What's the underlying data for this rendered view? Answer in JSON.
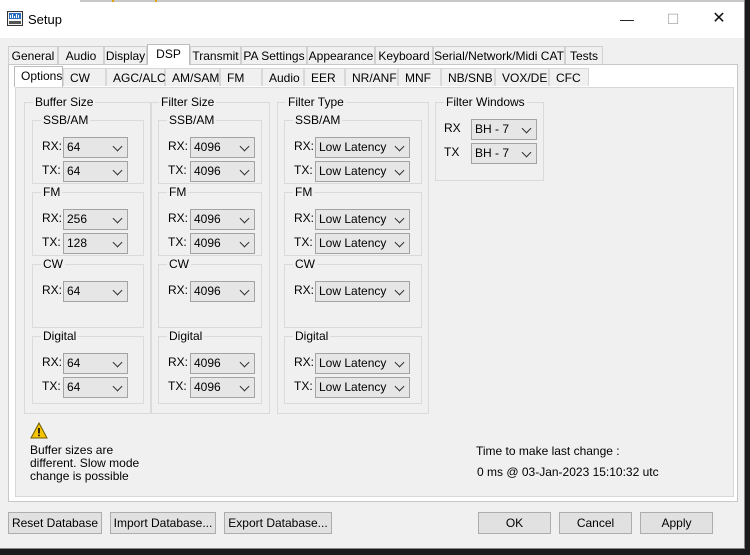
{
  "window": {
    "title": "Setup",
    "min_icon": "minimize-icon",
    "max_icon": "maximize-icon",
    "close_icon": "close-icon"
  },
  "tabs_top": [
    {
      "label": "General"
    },
    {
      "label": "Audio"
    },
    {
      "label": "Display"
    },
    {
      "label": "DSP",
      "active": true
    },
    {
      "label": "Transmit"
    },
    {
      "label": "PA Settings"
    },
    {
      "label": "Appearance"
    },
    {
      "label": "Keyboard"
    },
    {
      "label": "Serial/Network/Midi CAT"
    },
    {
      "label": "Tests"
    }
  ],
  "tabs_dsp": [
    {
      "label": "Options",
      "active": true
    },
    {
      "label": "CW"
    },
    {
      "label": "AGC/ALC"
    },
    {
      "label": "AM/SAM"
    },
    {
      "label": "FM"
    },
    {
      "label": "Audio"
    },
    {
      "label": "EER"
    },
    {
      "label": "NR/ANF"
    },
    {
      "label": "MNF"
    },
    {
      "label": "NB/SNB"
    },
    {
      "label": "VOX/DE"
    },
    {
      "label": "CFC"
    }
  ],
  "buffer_size": {
    "title": "Buffer Size",
    "ssbam": {
      "title": "SSB/AM",
      "rx_label": "RX:",
      "rx": "64",
      "tx_label": "TX:",
      "tx": "64"
    },
    "fm": {
      "title": "FM",
      "rx_label": "RX:",
      "rx": "256",
      "tx_label": "TX:",
      "tx": "128"
    },
    "cw": {
      "title": "CW",
      "rx_label": "RX:",
      "rx": "64"
    },
    "digital": {
      "title": "Digital",
      "rx_label": "RX:",
      "rx": "64",
      "tx_label": "TX:",
      "tx": "64"
    }
  },
  "filter_size": {
    "title": "Filter Size",
    "ssbam": {
      "title": "SSB/AM",
      "rx_label": "RX:",
      "rx": "4096",
      "tx_label": "TX:",
      "tx": "4096"
    },
    "fm": {
      "title": "FM",
      "rx_label": "RX:",
      "rx": "4096",
      "tx_label": "TX:",
      "tx": "4096"
    },
    "cw": {
      "title": "CW",
      "rx_label": "RX:",
      "rx": "4096"
    },
    "digital": {
      "title": "Digital",
      "rx_label": "RX:",
      "rx": "4096",
      "tx_label": "TX:",
      "tx": "4096"
    }
  },
  "filter_type": {
    "title": "Filter Type",
    "ssbam": {
      "title": "SSB/AM",
      "rx_label": "RX:",
      "rx": "Low Latency",
      "tx_label": "TX:",
      "tx": "Low Latency"
    },
    "fm": {
      "title": "FM",
      "rx_label": "RX:",
      "rx": "Low Latency",
      "tx_label": "TX:",
      "tx": "Low Latency"
    },
    "cw": {
      "title": "CW",
      "rx_label": "RX:",
      "rx": "Low Latency"
    },
    "digital": {
      "title": "Digital",
      "rx_label": "RX:",
      "rx": "Low Latency",
      "tx_label": "TX:",
      "tx": "Low Latency"
    }
  },
  "filter_windows": {
    "title": "Filter Windows",
    "rx_label": "RX",
    "rx": "BH - 7",
    "tx_label": "TX",
    "tx": "BH - 7"
  },
  "warning": {
    "icon": "warning-icon",
    "text": "Buffer sizes are\ndifferent. Slow mode\nchange is possible"
  },
  "timing": {
    "label": "Time to make last change :",
    "value": "0 ms @ 03-Jan-2023 15:10:32 utc"
  },
  "buttons": {
    "reset": "Reset Database",
    "import": "Import Database...",
    "export": "Export Database...",
    "ok": "OK",
    "cancel": "Cancel",
    "apply": "Apply"
  },
  "colors": {
    "window_bg": "#f0f0f0",
    "warning_yellow": "#f5c400"
  }
}
